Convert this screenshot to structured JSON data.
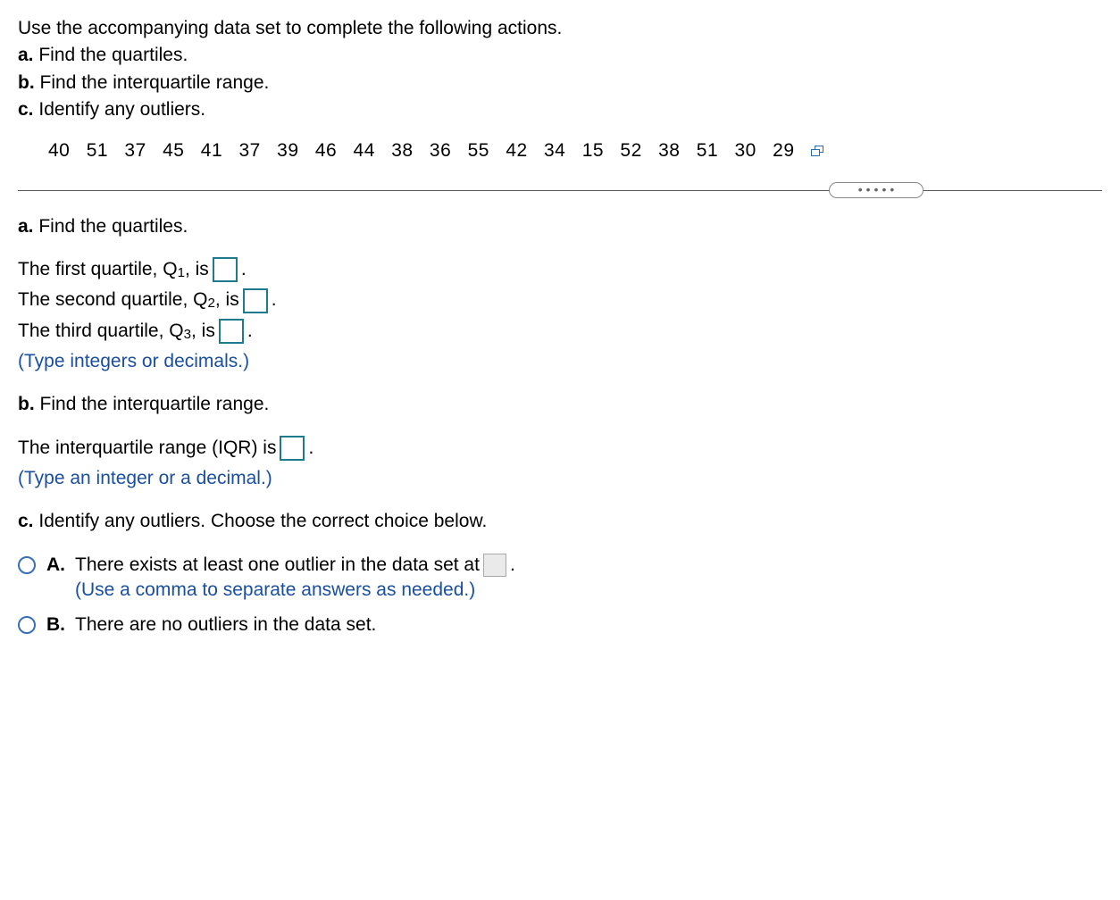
{
  "intro": {
    "lead": "Use the accompanying data set to complete the following actions.",
    "a": "Find the quartiles.",
    "b": "Find the interquartile range.",
    "c": "Identify any outliers."
  },
  "labels": {
    "a": "a.",
    "b": "b.",
    "c": "c."
  },
  "data_values": "40  51  37  45  41  37  39  46  44  38  36  55  42  34  15  52  38  51  30  29",
  "dots": "•••••",
  "partA": {
    "heading": "Find the quartiles.",
    "q1_pre": "The first quartile, Q",
    "q1_sub": "1",
    "q2_pre": "The second quartile, Q",
    "q2_sub": "2",
    "q3_pre": "The third quartile, Q",
    "q3_sub": "3",
    "is_text": ", is",
    "period": ".",
    "hint": "(Type integers or decimals.)"
  },
  "partB": {
    "heading": "Find the interquartile range.",
    "line": "The interquartile range (IQR) is",
    "period": ".",
    "hint": "(Type an integer or a decimal.)"
  },
  "partC": {
    "heading": "Identify any outliers. Choose the correct choice below.",
    "optA_label": "A.",
    "optA_text": "There exists at least one outlier in the data set at",
    "optA_period": ".",
    "optA_hint": "(Use a comma to separate answers as needed.)",
    "optB_label": "B.",
    "optB_text": "There are no outliers in the data set."
  }
}
